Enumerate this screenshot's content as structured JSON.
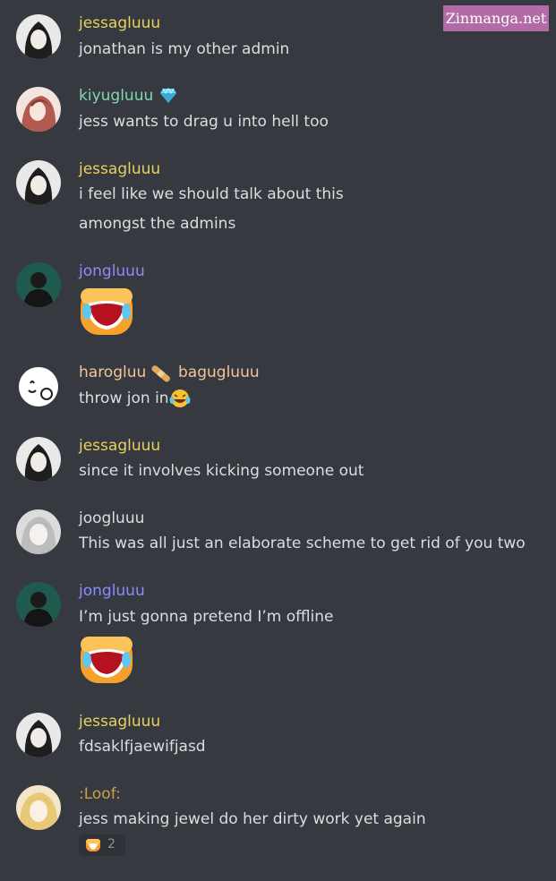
{
  "watermark": "Zinmanga.net",
  "colors": {
    "background": "#36393f",
    "jess": "#e8d15d",
    "kiyu": "#7fd8b0",
    "jong": "#8b8cff",
    "harog": "#f2c49b",
    "joog": "#dcddde",
    "loof": "#c9a04a",
    "text": "#dcddde"
  },
  "messages": [
    {
      "author": "jessagluuu",
      "lines": [
        "jonathan is my other admin"
      ]
    },
    {
      "author": "kiyugluuu",
      "badge_icon": "gem-icon",
      "lines": [
        "jess wants to drag u into hell too"
      ]
    },
    {
      "author": "jessagluuu",
      "lines": [
        "i feel like we should talk about this",
        "amongst the admins"
      ]
    },
    {
      "author": "jongluuu",
      "lines": [],
      "emoji": "crying-laughing-blob-emoji"
    },
    {
      "author": "harogluu",
      "separator_icon": "bandage-icon",
      "author2": "bagugluuu",
      "lines": [
        "throw jon in"
      ],
      "inline_emoji": "crying-laughing-emoji"
    },
    {
      "author": "jessagluuu",
      "lines": [
        "since it involves kicking someone out"
      ]
    },
    {
      "author": "joogluuu",
      "lines": [
        "This was all just an elaborate scheme to get rid of you two"
      ]
    },
    {
      "author": "jongluuu",
      "lines": [
        "I’m just gonna pretend I’m offline"
      ],
      "emoji": "crying-laughing-blob-emoji"
    },
    {
      "author": "jessagluuu",
      "lines": [
        "fdsaklfjaewifjasd"
      ]
    },
    {
      "author": ":Loof:",
      "lines": [
        "jess making jewel do her dirty work yet again"
      ],
      "reaction": {
        "icon": "blob-emoji",
        "count": "2"
      }
    }
  ]
}
